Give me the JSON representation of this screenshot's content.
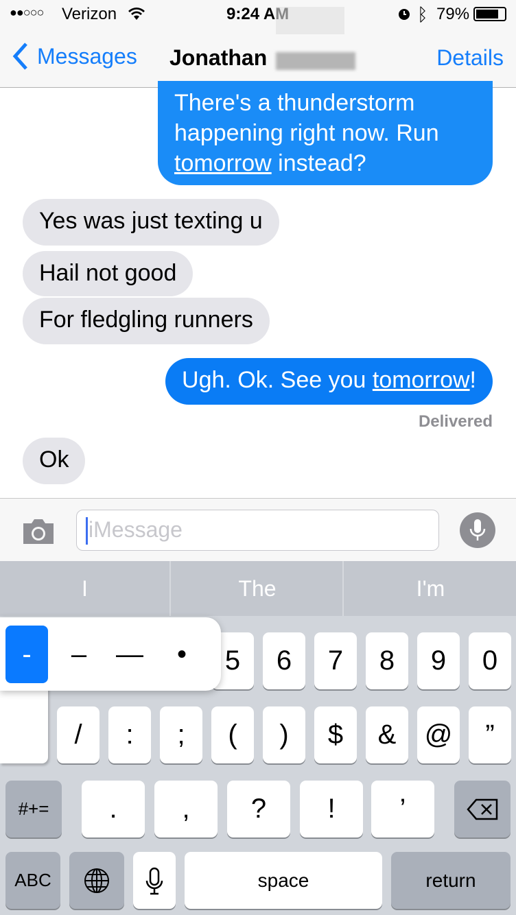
{
  "status_bar": {
    "signal": "●●○○○",
    "carrier": "Verizon",
    "time": "9:24 AM",
    "battery": "79%",
    "icons": [
      "wifi-icon",
      "alarm-icon",
      "bluetooth-icon",
      "battery-icon"
    ]
  },
  "nav": {
    "back_label": "Messages",
    "title": "Jonathan",
    "details_label": "Details"
  },
  "messages": [
    {
      "from": "me",
      "pre": "There's a thunderstorm happening right now. Run ",
      "link": "tomorrow",
      "post": " instead?"
    },
    {
      "from": "them",
      "text": "Yes was just texting u"
    },
    {
      "from": "them",
      "text": "Hail not good"
    },
    {
      "from": "them",
      "text": "For fledgling runners"
    },
    {
      "from": "me",
      "pre": "Ugh. Ok. See you ",
      "link": "tomorrow",
      "post": "!"
    },
    {
      "from": "them",
      "text": "Ok"
    }
  ],
  "delivered": "Delivered",
  "input": {
    "placeholder": "iMessage"
  },
  "predictions": [
    "I",
    "The",
    "I'm"
  ],
  "popup_alternates": [
    "-",
    "–",
    "—",
    "•"
  ],
  "keyboard": {
    "row1": [
      "5",
      "6",
      "7",
      "8",
      "9",
      "0"
    ],
    "row2": [
      "/",
      ":",
      ";",
      "(",
      ")",
      "$",
      "&",
      "@",
      "”"
    ],
    "row3": [
      ".",
      ",",
      "?",
      "!",
      "’"
    ],
    "symbols": "#+=",
    "abc": "ABC",
    "space": "space",
    "return": "return"
  },
  "colors": {
    "accent": "#157efb",
    "sent_bubble": "#1a8cf7",
    "received_bubble": "#e5e5ea"
  }
}
